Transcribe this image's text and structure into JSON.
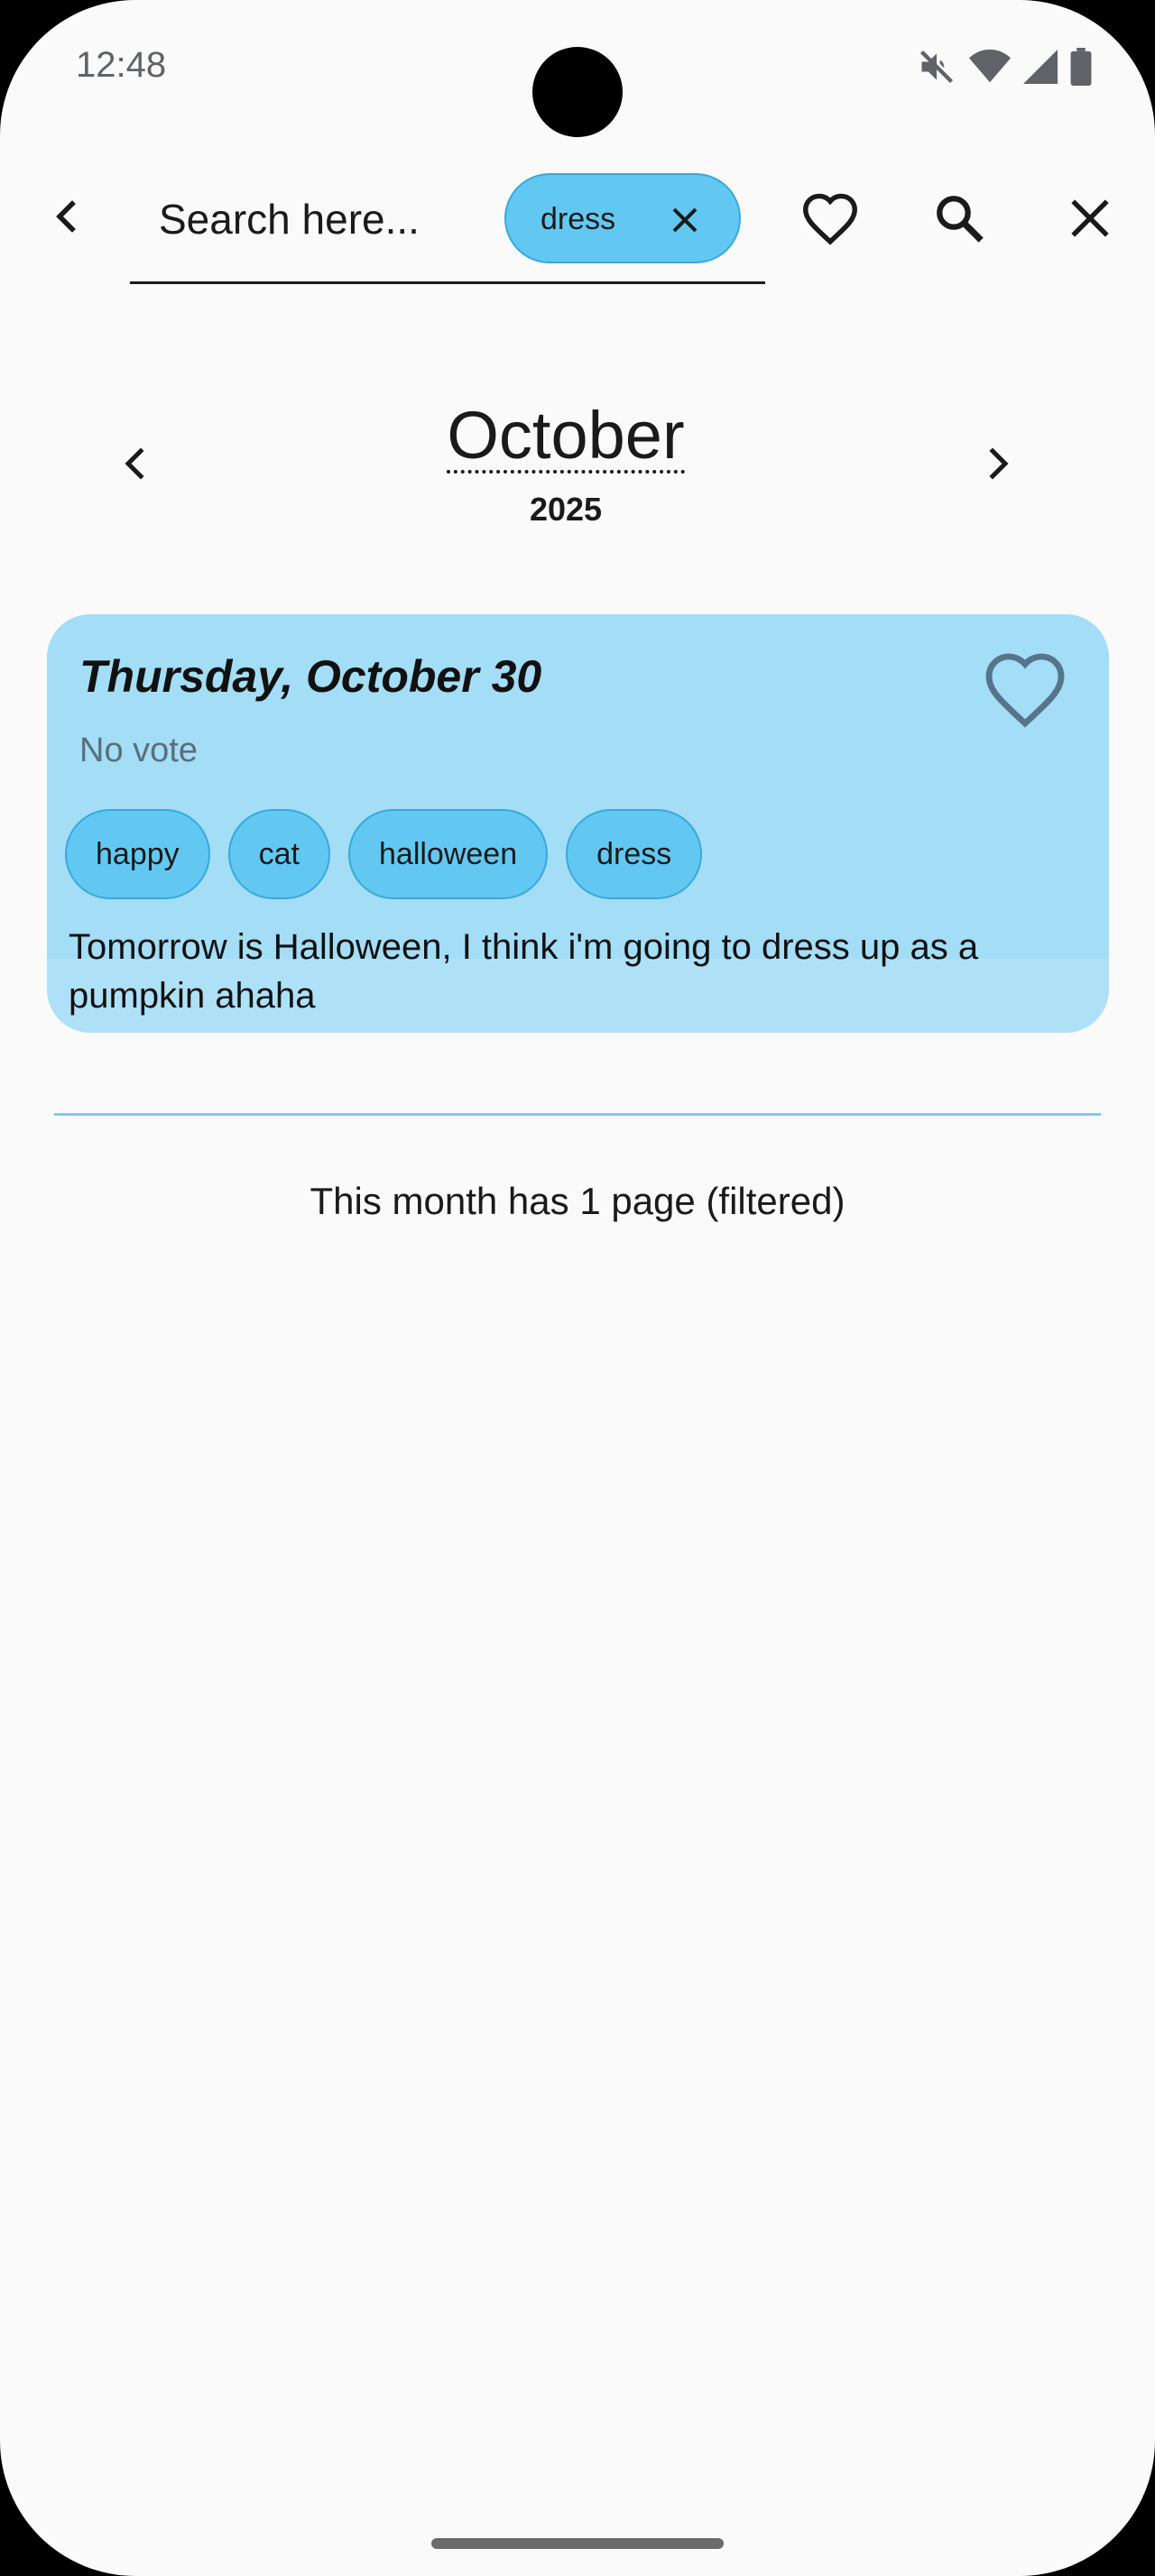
{
  "status_bar": {
    "time": "12:48",
    "icons": [
      "mute-icon",
      "wifi-icon",
      "signal-icon",
      "battery-icon"
    ]
  },
  "appbar": {
    "search_placeholder": "Search here...",
    "search_value": "",
    "active_filter_chip": "dress",
    "actions": [
      "favorites-heart-icon",
      "search-icon",
      "close-icon"
    ]
  },
  "month": {
    "name": "October",
    "year": "2025"
  },
  "entries": [
    {
      "date": "Thursday, October 30",
      "vote": "No vote",
      "favorited": false,
      "tags": [
        "happy",
        "cat",
        "halloween",
        "dress"
      ],
      "text": "Tomorrow is Halloween, I think i'm going to dress up as a pumpkin ahaha"
    }
  ],
  "footer": {
    "page_count_text": "This month has 1 page (filtered)"
  },
  "colors": {
    "background": "#fafafa",
    "card": "#a3ddf6",
    "chip": "#62c8f2",
    "chip_border": "#37a9dc",
    "divider": "#7dcaef"
  }
}
